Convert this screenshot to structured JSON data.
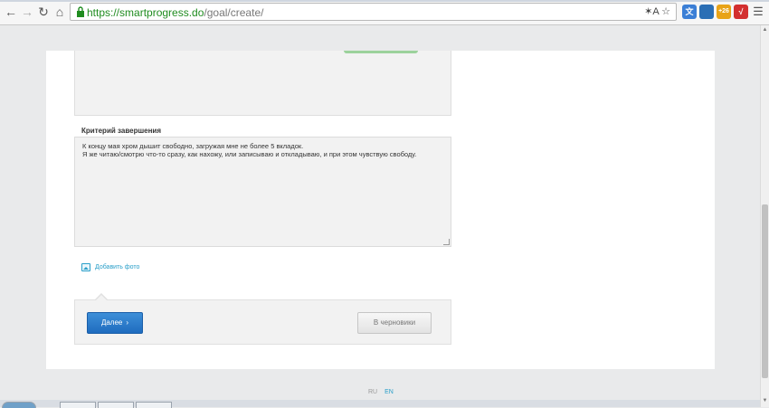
{
  "browser": {
    "url_scheme": "https://",
    "url_host": "smartprogress.do",
    "url_path": "/goal/create/",
    "translate_label": "✶A",
    "extensions": [
      {
        "name": "translate-ext",
        "color": "#3b7fd6",
        "label": "文"
      },
      {
        "name": "ext-blue",
        "color": "#2b6fb5",
        "label": ""
      },
      {
        "name": "notifications",
        "color": "#e8a317",
        "label": "+26"
      },
      {
        "name": "antivirus",
        "color": "#d32f2f",
        "label": "√"
      }
    ]
  },
  "form": {
    "completion_label": "Критерий завершения",
    "completion_text_line1": "К концу мая хром дышит свободно, загружая мне не более 5 вкладок.",
    "completion_text_line2": "Я же читаю/смотрю что-то сразу, как нахожу, или записываю и откладываю, и при этом чувствую свободу.",
    "add_photo_label": "Добавить фото",
    "next_label": "Далее",
    "next_chevron": "›",
    "draft_label": "В черновики"
  },
  "footer": {
    "lang_ru": "RU",
    "lang_en": "EN"
  },
  "colors": {
    "accent": "#2a9fc9",
    "primary_button": "#2a7bcb",
    "url_host": "#1f8c1f"
  }
}
